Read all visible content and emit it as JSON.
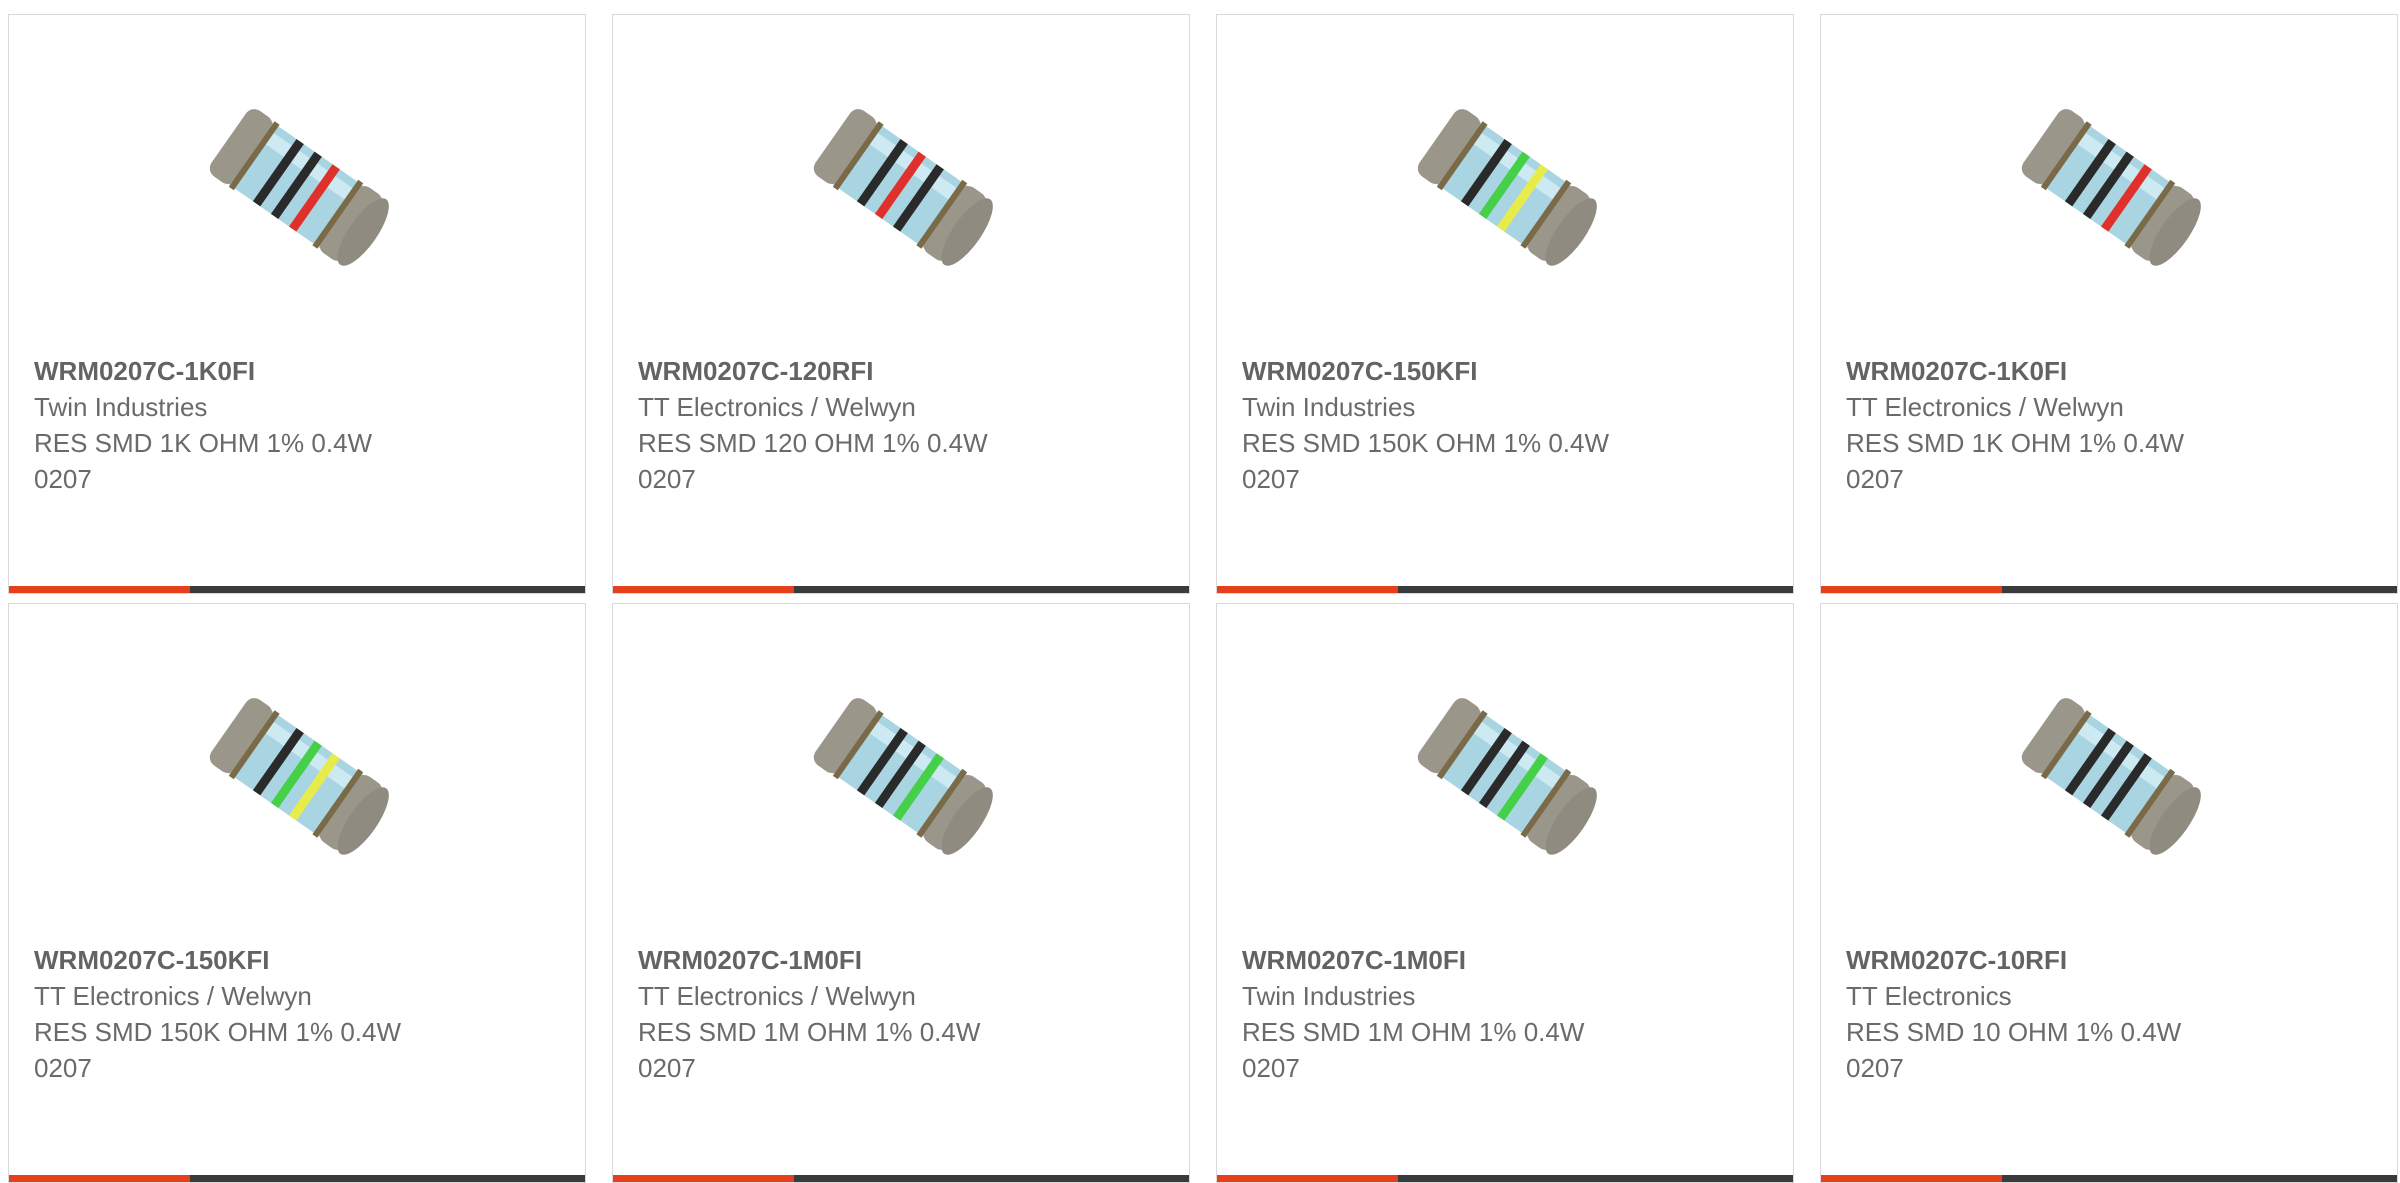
{
  "products": [
    {
      "part": "WRM0207C-1K0FI",
      "manufacturer": "Twin Industries",
      "description": "RES SMD 1K OHM 1% 0.4W\n0207",
      "bands": [
        "#2a2a2a",
        "#2a2a2a",
        "#e0302c"
      ]
    },
    {
      "part": "WRM0207C-120RFI",
      "manufacturer": "TT Electronics / Welwyn",
      "description": "RES SMD 120 OHM 1% 0.4W\n0207",
      "bands": [
        "#2a2a2a",
        "#e0302c",
        "#2a2a2a"
      ]
    },
    {
      "part": "WRM0207C-150KFI",
      "manufacturer": "Twin Industries",
      "description": "RES SMD 150K OHM 1% 0.4W\n0207",
      "bands": [
        "#2a2a2a",
        "#46d04a",
        "#e8ec4a"
      ]
    },
    {
      "part": "WRM0207C-1K0FI",
      "manufacturer": "TT Electronics / Welwyn",
      "description": "RES SMD 1K OHM 1% 0.4W\n0207",
      "bands": [
        "#2a2a2a",
        "#2a2a2a",
        "#e0302c"
      ]
    },
    {
      "part": "WRM0207C-150KFI",
      "manufacturer": "TT Electronics / Welwyn",
      "description": "RES SMD 150K OHM 1% 0.4W\n0207",
      "bands": [
        "#2a2a2a",
        "#46d04a",
        "#e8ec4a"
      ]
    },
    {
      "part": "WRM0207C-1M0FI",
      "manufacturer": "TT Electronics / Welwyn",
      "description": "RES SMD 1M OHM 1% 0.4W\n0207",
      "bands": [
        "#2a2a2a",
        "#2a2a2a",
        "#46d04a"
      ]
    },
    {
      "part": "WRM0207C-1M0FI",
      "manufacturer": "Twin Industries",
      "description": "RES SMD 1M OHM 1% 0.4W\n0207",
      "bands": [
        "#2a2a2a",
        "#2a2a2a",
        "#46d04a"
      ]
    },
    {
      "part": "WRM0207C-10RFI",
      "manufacturer": "TT Electronics",
      "description": "RES SMD 10 OHM 1% 0.4W\n0207",
      "bands": [
        "#2a2a2a",
        "#2a2a2a",
        "#2a2a2a"
      ]
    }
  ],
  "colors": {
    "accent": "#e5401a",
    "bar": "#3a3a3a",
    "resistor_body": "#a9d4e2",
    "resistor_cap": "#9b968a"
  },
  "icons": {
    "product_image": "resistor-icon"
  }
}
